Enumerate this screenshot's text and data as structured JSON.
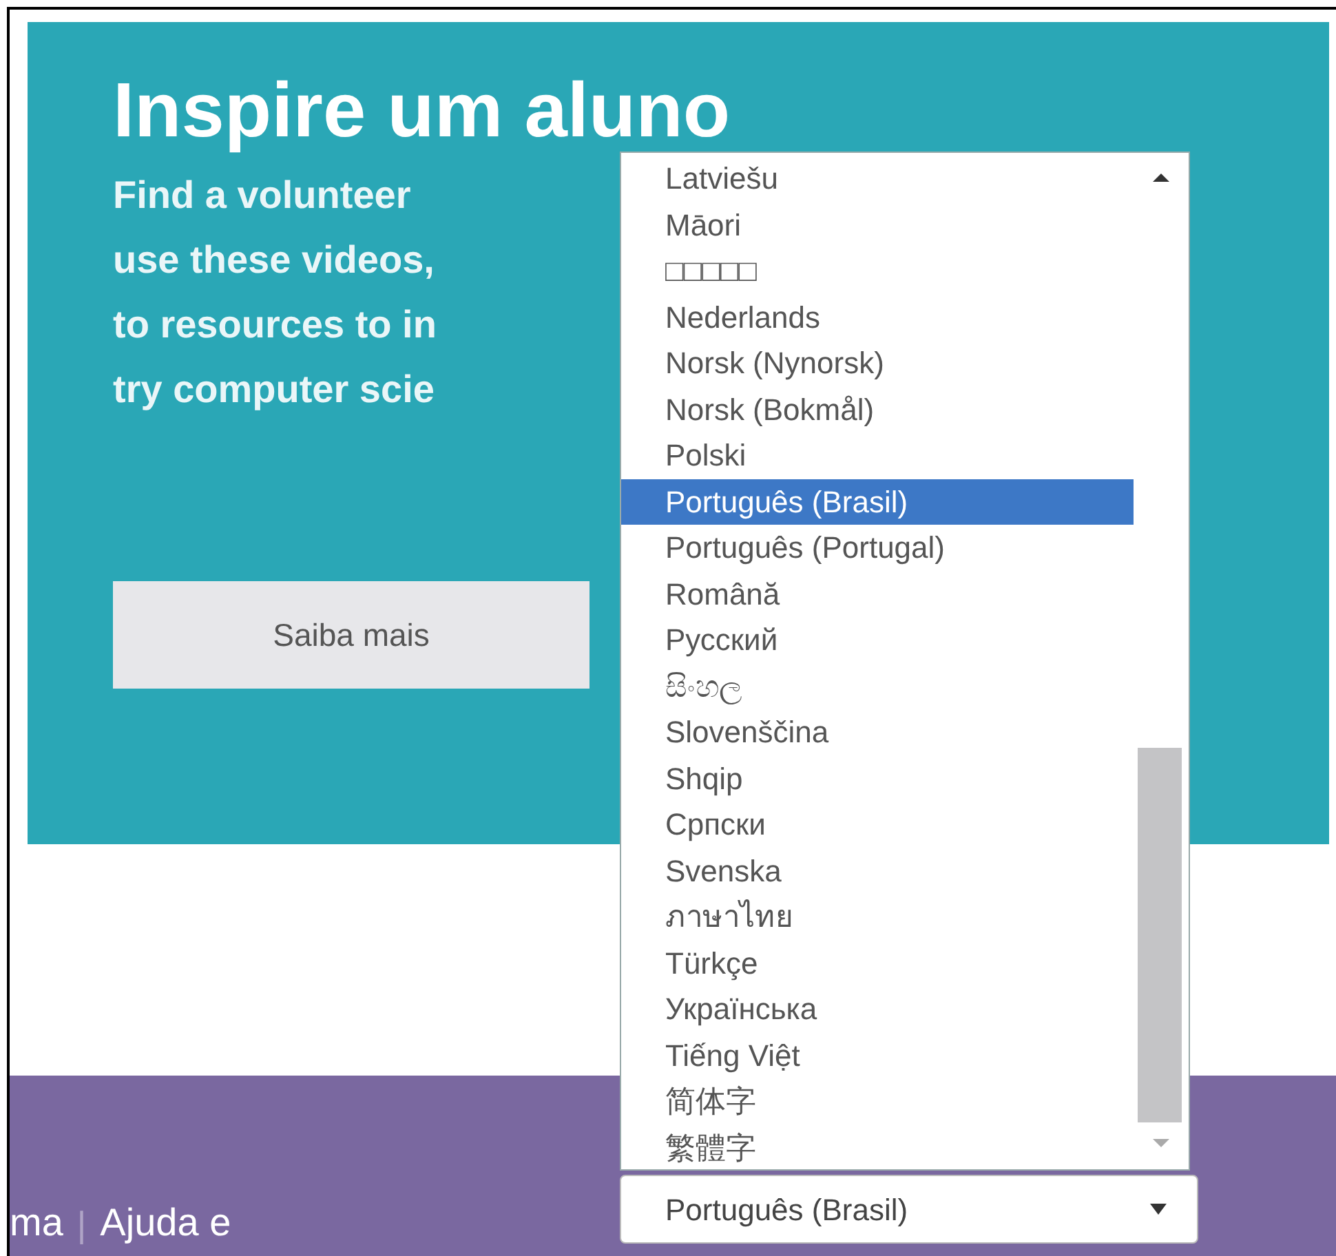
{
  "hero": {
    "heading": "Inspire um aluno",
    "body_lines": [
      "Find a volunteer",
      "use these videos,",
      "to resources to in",
      "try computer scie"
    ],
    "button": "Saiba mais"
  },
  "footer": {
    "links": [
      "ma",
      "|",
      "Ajuda e"
    ]
  },
  "language_list": {
    "items": [
      {
        "label": "Latviešu",
        "selected": false
      },
      {
        "label": "Māori",
        "selected": false
      },
      {
        "label": "□□□□□",
        "selected": false
      },
      {
        "label": "Nederlands",
        "selected": false
      },
      {
        "label": "Norsk (Nynorsk)",
        "selected": false
      },
      {
        "label": "Norsk (Bokmål)",
        "selected": false
      },
      {
        "label": "Polski",
        "selected": false
      },
      {
        "label": "Português (Brasil)",
        "selected": true
      },
      {
        "label": "Português (Portugal)",
        "selected": false
      },
      {
        "label": "Română",
        "selected": false
      },
      {
        "label": "Русский",
        "selected": false
      },
      {
        "label": "සිංහල",
        "selected": false
      },
      {
        "label": "Slovenščina",
        "selected": false
      },
      {
        "label": "Shqip",
        "selected": false
      },
      {
        "label": "Српски",
        "selected": false
      },
      {
        "label": "Svenska",
        "selected": false
      },
      {
        "label": "ภาษาไทย",
        "selected": false
      },
      {
        "label": "Türkçe",
        "selected": false
      },
      {
        "label": "Українська",
        "selected": false
      },
      {
        "label": "Tiếng Việt",
        "selected": false
      },
      {
        "label": "简体字",
        "selected": false
      },
      {
        "label": "繁體字",
        "selected": false
      }
    ]
  },
  "language_select": {
    "value": "Português (Brasil)"
  }
}
